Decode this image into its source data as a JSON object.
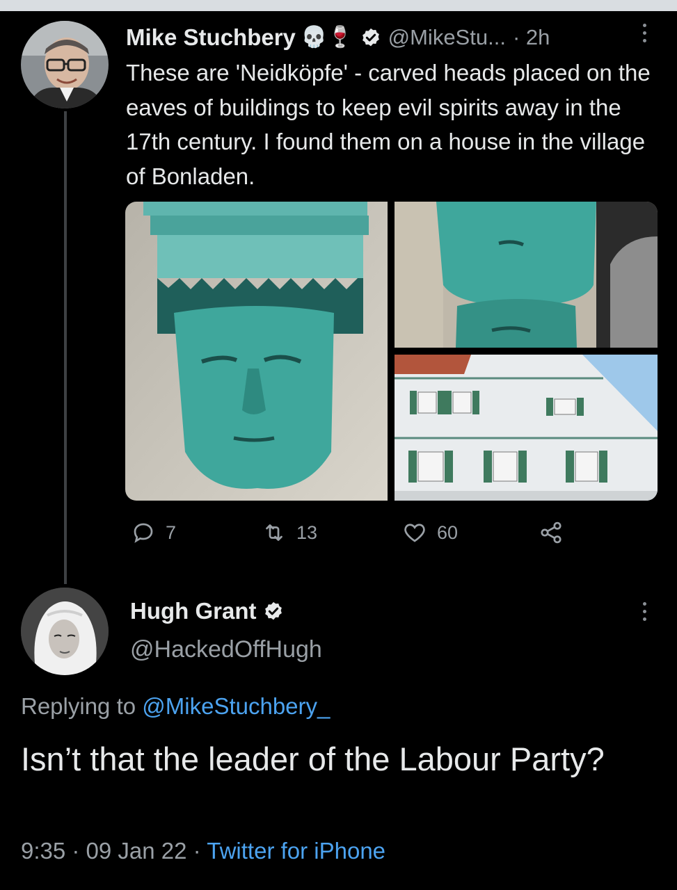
{
  "tweet": {
    "author_name": "Mike Stuchbery",
    "author_emojis": "💀🍷",
    "handle": "@MikeStu...",
    "time": "· 2h",
    "text": "These are 'Neidköpfe' - carved heads placed on the eaves of buildings to keep evil spirits away in the 17th century. I found them on a house in the village of Bonladen.",
    "replies": "7",
    "retweets": "13",
    "likes": "60"
  },
  "reply": {
    "author_name": "Hugh Grant",
    "handle": "@HackedOffHugh",
    "replying_prefix": "Replying to ",
    "replying_to": "@MikeStuchbery_",
    "text": "Isn’t that the leader of the Labour Party?",
    "time": "9:35 · 09 Jan 22 · ",
    "source": "Twitter for iPhone"
  },
  "colors": {
    "background": "#000000",
    "text": "#e7e9ea",
    "muted": "#9aa0a6",
    "link": "#4ca3f0"
  }
}
